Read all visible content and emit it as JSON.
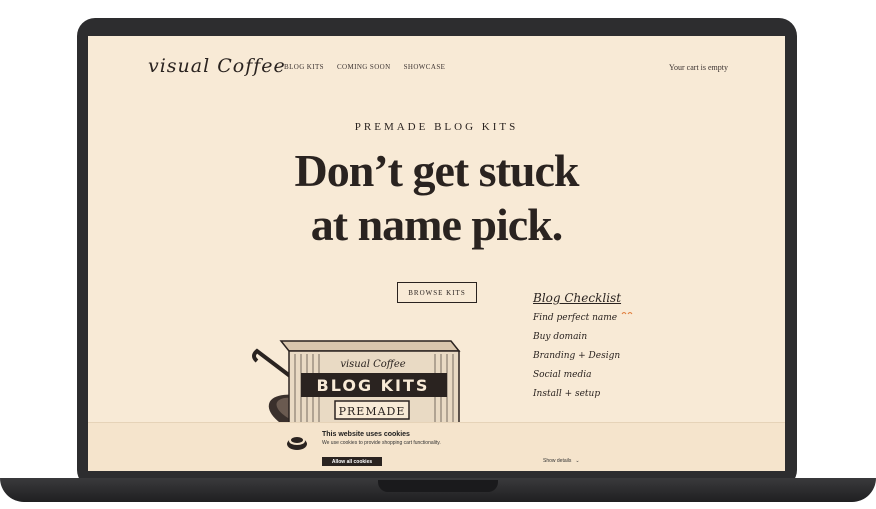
{
  "header": {
    "logo": "visual Coffee",
    "nav": [
      "BLOG KITS",
      "COMING SOON",
      "SHOWCASE"
    ],
    "cart": "Your cart is empty"
  },
  "hero": {
    "eyebrow": "PREMADE BLOG KITS",
    "line1": "Don’t get stuck",
    "line2": "at name pick.",
    "button": "BROWSE KITS"
  },
  "illustration": {
    "box_brand": "visual Coffee",
    "box_title": "BLOG KITS",
    "box_label": "PREMADE"
  },
  "checklist": {
    "title": "Blog Checklist",
    "items": [
      "Find perfect name",
      "Buy domain",
      "Branding + Design",
      "Social media",
      "Install + setup"
    ]
  },
  "cookie": {
    "title": "This website uses cookies",
    "text": "We use cookies to provide shopping cart functionality.",
    "accept": "Allow all cookies",
    "details": "Show details",
    "details_icon": "chevron-down-icon"
  },
  "colors": {
    "background": "#f8ead6",
    "ink": "#2a2320",
    "laptop": "#2d2d2f",
    "accent": "#e07b39"
  }
}
